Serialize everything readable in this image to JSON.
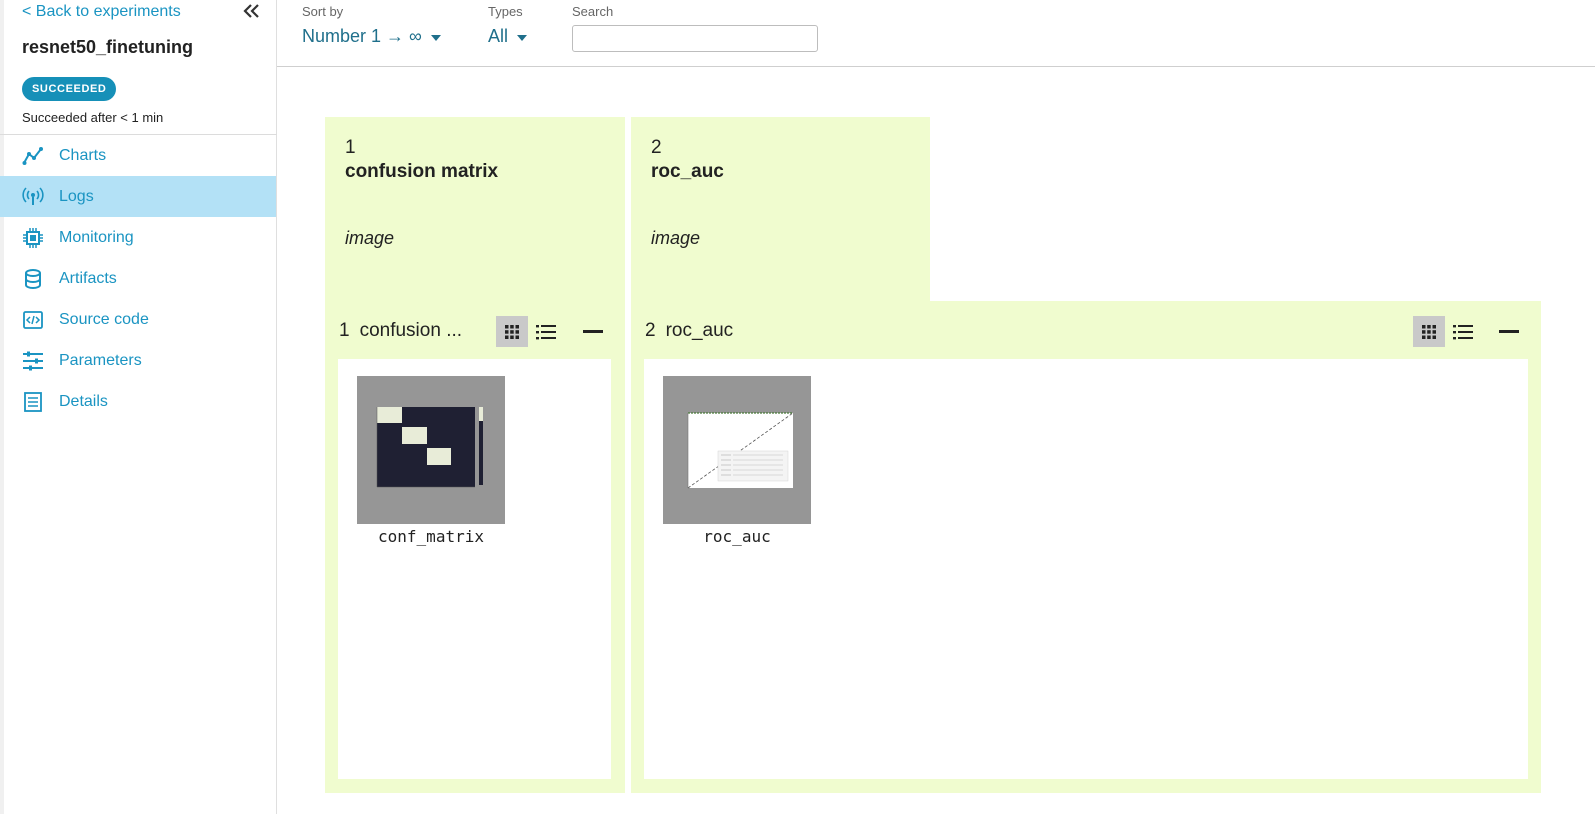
{
  "sidebar": {
    "back_label": "< Back to experiments",
    "experiment_name": "resnet50_finetuning",
    "status_badge": "SUCCEEDED",
    "status_text": "Succeeded after < 1 min",
    "items": [
      {
        "label": "Charts",
        "icon": "chart-line-icon"
      },
      {
        "label": "Logs",
        "icon": "antenna-icon"
      },
      {
        "label": "Monitoring",
        "icon": "chip-icon"
      },
      {
        "label": "Artifacts",
        "icon": "database-icon"
      },
      {
        "label": "Source code",
        "icon": "code-file-icon"
      },
      {
        "label": "Parameters",
        "icon": "sliders-icon"
      },
      {
        "label": "Details",
        "icon": "document-icon"
      }
    ],
    "active_item": "Logs"
  },
  "toolbar": {
    "sort_label": "Sort by",
    "sort_value": "Number 1 → ∞",
    "types_label": "Types",
    "types_value": "All",
    "search_label": "Search",
    "search_value": ""
  },
  "channels": [
    {
      "number": "1",
      "name": "confusion matrix",
      "type": "image"
    },
    {
      "number": "2",
      "name": "roc_auc",
      "type": "image"
    }
  ],
  "panels": [
    {
      "number": "1",
      "title": "confusion ...",
      "images": [
        {
          "caption": "conf_matrix"
        }
      ]
    },
    {
      "number": "2",
      "title": "roc_auc",
      "images": [
        {
          "caption": "roc_auc"
        }
      ]
    }
  ],
  "colors": {
    "accent": "#1a94c2",
    "active_nav": "#b3e1f6",
    "badge": "#1690b8",
    "card": "#f0fccf"
  }
}
